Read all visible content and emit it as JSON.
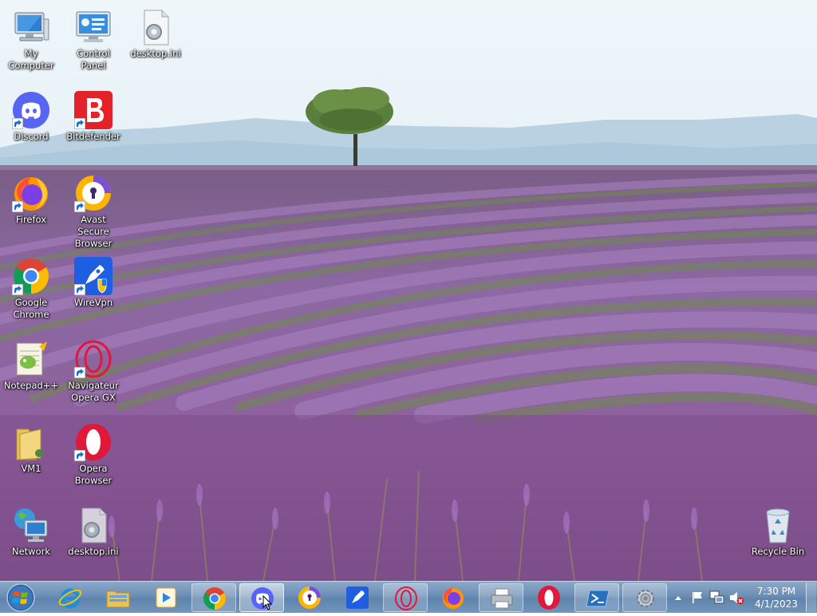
{
  "desktop": {
    "icons": [
      {
        "label": "My Computer",
        "icon": "my-computer-icon"
      },
      {
        "label": "Control Panel",
        "icon": "control-panel-icon"
      },
      {
        "label": "desktop.ini",
        "icon": "settings-file-icon"
      },
      {
        "label": "Discord",
        "icon": "discord-icon"
      },
      {
        "label": "Bitdefender",
        "icon": "bitdefender-icon"
      },
      {
        "label": "Firefox",
        "icon": "firefox-icon"
      },
      {
        "label": "Avast Secure Browser",
        "icon": "avast-browser-icon"
      },
      {
        "label": "Google Chrome",
        "icon": "chrome-icon"
      },
      {
        "label": "WireVpn",
        "icon": "wirevpn-icon"
      },
      {
        "label": "Notepad++",
        "icon": "notepad-plus-plus-icon"
      },
      {
        "label": "Navigateur Opera GX",
        "icon": "opera-gx-icon"
      },
      {
        "label": "VM1",
        "icon": "folder-icon"
      },
      {
        "label": "Opera Browser",
        "icon": "opera-icon"
      },
      {
        "label": "Network",
        "icon": "network-icon"
      },
      {
        "label": "desktop.ini",
        "icon": "settings-file-icon"
      },
      {
        "label": "Recycle Bin",
        "icon": "recycle-bin-icon"
      }
    ]
  },
  "taskbar": {
    "start_icon": "windows-start-icon",
    "items": [
      {
        "icon": "internet-explorer-icon",
        "state": "pinned"
      },
      {
        "icon": "file-explorer-icon",
        "state": "pinned"
      },
      {
        "icon": "media-player-icon",
        "state": "pinned"
      },
      {
        "icon": "chrome-icon",
        "state": "open"
      },
      {
        "icon": "discord-icon",
        "state": "active"
      },
      {
        "icon": "avast-browser-icon",
        "state": "pinned"
      },
      {
        "icon": "wirevpn-icon",
        "state": "pinned"
      },
      {
        "icon": "opera-gx-icon",
        "state": "open"
      },
      {
        "icon": "firefox-icon",
        "state": "pinned"
      },
      {
        "icon": "printer-icon",
        "state": "open"
      },
      {
        "icon": "opera-icon",
        "state": "pinned"
      },
      {
        "icon": "powershell-icon",
        "state": "open"
      },
      {
        "icon": "settings-gear-icon",
        "state": "open"
      }
    ],
    "tray": {
      "icons": [
        "show-hidden-icons-chevron",
        "action-center-flag-icon",
        "network-icon",
        "volume-muted-icon"
      ],
      "time": "7:30 PM",
      "date": "4/1/2023"
    }
  }
}
